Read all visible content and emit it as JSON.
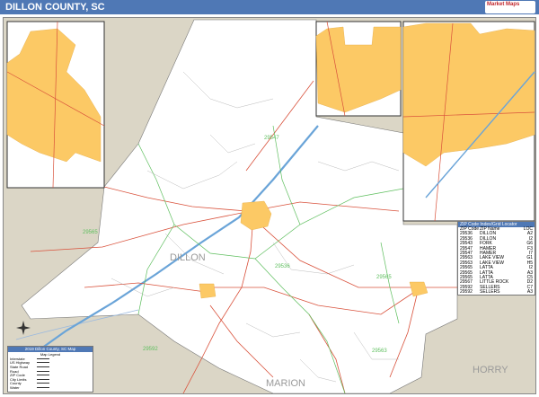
{
  "header": {
    "title": "DILLON COUNTY, SC",
    "logo_text": "Market Maps"
  },
  "map": {
    "county_label": "DILLON",
    "neighbor_labels": [
      "MARION",
      "HORRY"
    ],
    "zip_labels": [
      "29547",
      "29565",
      "29536",
      "29592",
      "29565",
      "29563"
    ],
    "colors": {
      "county_fill": "#ffffff",
      "outside_fill": "#dbd6c6",
      "urban_fill": "#fcc965",
      "road_red": "#d9513b",
      "zip_green": "#5fbf5f",
      "interstate_blue": "#6aa4d8",
      "header_blue": "#4f78b5"
    }
  },
  "zip_table": {
    "title": "ZIP Code Index/Grid Locator",
    "columns": [
      "ZIP Code",
      "ZIP Name",
      "LOC"
    ],
    "rows": [
      [
        "29536",
        "DILLON",
        "A2"
      ],
      [
        "29536",
        "DILLON",
        "I2"
      ],
      [
        "29543",
        "FORK",
        "G6"
      ],
      [
        "29547",
        "HAMER",
        "F3"
      ],
      [
        "29547",
        "HAMER",
        "I7"
      ],
      [
        "29563",
        "LAKE VIEW",
        "G1"
      ],
      [
        "29563",
        "LAKE VIEW",
        "H5"
      ],
      [
        "29565",
        "LATTA",
        "I2"
      ],
      [
        "29565",
        "LATTA",
        "A3"
      ],
      [
        "29565",
        "LATTA",
        "C5"
      ],
      [
        "29567",
        "LITTLE ROCK",
        "D2"
      ],
      [
        "29592",
        "SELLERS",
        "C7"
      ],
      [
        "29592",
        "SELLERS",
        "A3"
      ]
    ]
  },
  "legend": {
    "title": "2019 Dillon County, SC Map",
    "subtitle": "Map Legend",
    "items": [
      "Interstate",
      "US Highway",
      "State Road",
      "Road",
      "ZIP Code",
      "City Limits",
      "County",
      "Water"
    ]
  }
}
